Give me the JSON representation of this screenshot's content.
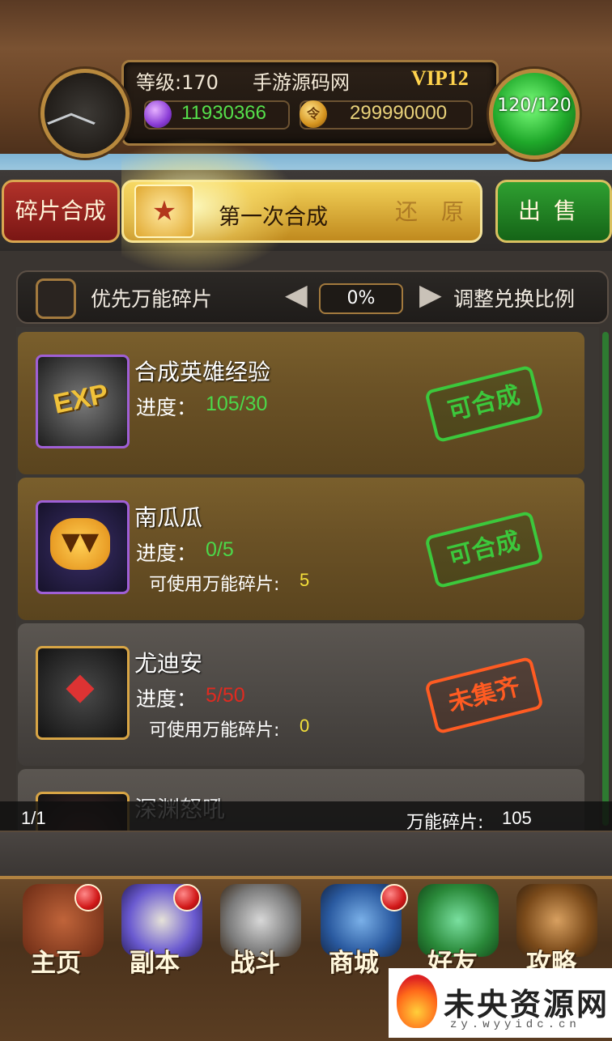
{
  "header": {
    "level": "等级:170",
    "username": "手游源码网",
    "vip": "VIP12",
    "gems": "11930366",
    "coins": "299990000",
    "coin_symbol": "令",
    "energy": "120/120"
  },
  "tabs": {
    "fragment_synth": "碎片合成",
    "first_synth": "第一次合成",
    "restore_ghost": "还 原",
    "sell": "出售",
    "badge_glyph": "★"
  },
  "options": {
    "prefer_universal": "优先万能碎片",
    "ratio": "0%",
    "adjust_ratio": "调整兑换比例"
  },
  "list": {
    "progress_label": "进度：",
    "universal_label": "可使用万能碎片:",
    "items": [
      {
        "name": "合成英雄经验",
        "progress": "105/30",
        "status": "可合成",
        "icon": "exp-puzzle-icon"
      },
      {
        "name": "南瓜瓜",
        "progress": "0/5",
        "universal": "5",
        "status": "可合成",
        "icon": "pumpkin-puzzle-icon"
      },
      {
        "name": "尤迪安",
        "progress": "5/50",
        "universal": "0",
        "status": "未集齐",
        "icon": "demon-puzzle-icon"
      },
      {
        "name": "深渊怒吼",
        "icon": "abyss-puzzle-icon"
      }
    ],
    "exp_text": "EXP"
  },
  "footer": {
    "page": "1/1",
    "universal_total_label": "万能碎片:",
    "universal_total": "105"
  },
  "nav": [
    {
      "label": "主页",
      "icon": "home-icon",
      "badge": true
    },
    {
      "label": "副本",
      "icon": "dungeon-icon",
      "badge": true
    },
    {
      "label": "战斗",
      "icon": "battle-icon",
      "badge": false
    },
    {
      "label": "商城",
      "icon": "shop-icon",
      "badge": true
    },
    {
      "label": "好友",
      "icon": "friends-icon",
      "badge": false
    },
    {
      "label": "攻略",
      "icon": "guide-icon",
      "badge": false
    }
  ],
  "watermark": {
    "text": "未央资源网",
    "url": "zy.wyyidc.cn"
  },
  "colors": {
    "progress_ok": "#4cd84a",
    "progress_short": "#e02a20",
    "status_ready": "#3cc83c",
    "status_missing": "#ff5b22",
    "universal_value": "#f4e03a"
  }
}
